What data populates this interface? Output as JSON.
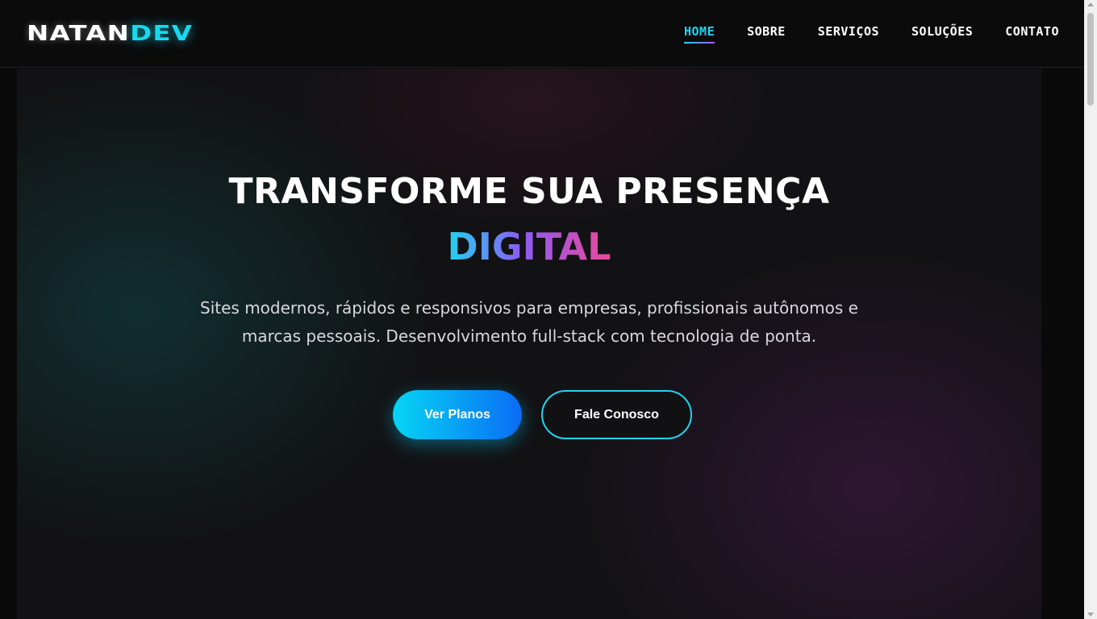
{
  "brand": {
    "logo_part1": "NATAN",
    "logo_part2": "DEV"
  },
  "nav": {
    "items": [
      {
        "label": "HOME",
        "active": true
      },
      {
        "label": "SOBRE",
        "active": false
      },
      {
        "label": "SERVIÇOS",
        "active": false
      },
      {
        "label": "SOLUÇÕES",
        "active": false
      },
      {
        "label": "CONTATO",
        "active": false
      }
    ]
  },
  "hero": {
    "title": "TRANSFORME SUA PRESENÇA",
    "highlight": "DIGITAL",
    "description": "Sites modernos, rápidos e responsivos para empresas, profissionais autônomos e marcas pessoais. Desenvolvimento full-stack com tecnologia de ponta.",
    "primary_button": "Ver Planos",
    "secondary_button": "Fale Conosco"
  },
  "colors": {
    "accent_cyan": "#22d3ee",
    "accent_blue": "#0a6cf5",
    "accent_purple": "#8b5cf6",
    "accent_pink": "#ec4899",
    "background": "#121214"
  }
}
